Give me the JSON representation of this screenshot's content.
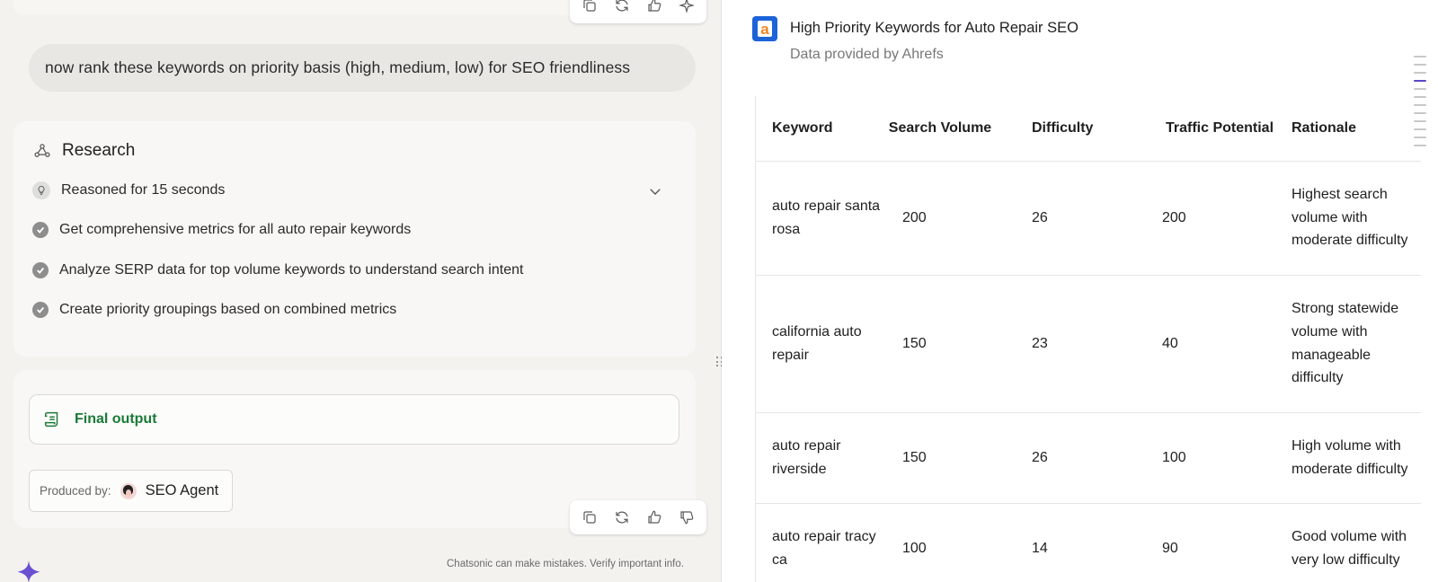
{
  "chat": {
    "user_message": "now rank these keywords on priority basis (high, medium, low) for SEO friendliness",
    "research": {
      "title": "Research",
      "reasoned_label": "Reasoned for 15 seconds",
      "steps": [
        "Get comprehensive metrics for all auto repair keywords",
        "Analyze SERP data for top volume keywords to understand search intent",
        "Create priority groupings based on combined metrics"
      ]
    },
    "final_output_label": "Final output",
    "produced_by_label": "Produced by:",
    "agent_name": "SEO Agent",
    "disclaimer": "Chatsonic can make mistakes. Verify important info."
  },
  "doc": {
    "title": "High Priority Keywords for Auto Repair SEO",
    "subtitle": "Data provided by Ahrefs",
    "logo_text": "a",
    "table": {
      "headers": [
        "Keyword",
        "Search Volume",
        "Difficulty",
        "Traffic Potential",
        "Rationale"
      ],
      "rows": [
        {
          "keyword": "auto repair santa rosa",
          "volume": "200",
          "difficulty": "26",
          "traffic": "200",
          "rationale": "Highest search volume with moderate difficulty"
        },
        {
          "keyword": "california auto repair",
          "volume": "150",
          "difficulty": "23",
          "traffic": "40",
          "rationale": "Strong statewide volume with manageable difficulty"
        },
        {
          "keyword": "auto repair riverside",
          "volume": "150",
          "difficulty": "26",
          "traffic": "100",
          "rationale": "High volume with moderate difficulty"
        },
        {
          "keyword": "auto repair tracy ca",
          "volume": "100",
          "difficulty": "14",
          "traffic": "90",
          "rationale": "Good volume with very low difficulty"
        }
      ]
    }
  },
  "colors": {
    "accent": "#6a4fd1",
    "success_green": "#1a7a36",
    "ahrefs_blue": "#1d63d8",
    "ahrefs_orange": "#f28520"
  },
  "icons": {
    "message_actions": [
      "copy-icon",
      "regenerate-icon",
      "thumbs-up-icon",
      "thumbs-down-icon"
    ],
    "research": "webhook-icon",
    "reasoned": "lightbulb-icon",
    "step": "check-circle-icon",
    "final_output": "scroll-icon",
    "brand": "sparkle-icon"
  }
}
